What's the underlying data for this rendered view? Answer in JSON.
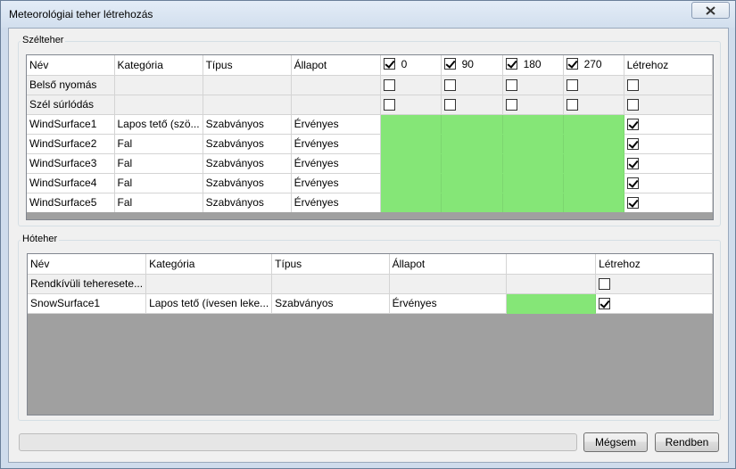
{
  "window": {
    "title": "Meteorológiai teher létrehozás"
  },
  "wind": {
    "group_label": "Szélteher",
    "columns": [
      "Név",
      "Kategória",
      "Típus",
      "Állapot",
      "0",
      "90",
      "180",
      "270",
      "Létrehoz"
    ],
    "header_checks": [
      true,
      true,
      true,
      true
    ],
    "special_rows": [
      {
        "name": "Belső nyomás",
        "checks": [
          false,
          false,
          false,
          false
        ],
        "create": false
      },
      {
        "name": "Szél súrlódás",
        "checks": [
          false,
          false,
          false,
          false
        ],
        "create": false
      }
    ],
    "rows": [
      {
        "name": "WindSurface1",
        "category": "Lapos tető (szö...",
        "type": "Szabványos",
        "status": "Érvényes",
        "create": true
      },
      {
        "name": "WindSurface2",
        "category": "Fal",
        "type": "Szabványos",
        "status": "Érvényes",
        "create": true
      },
      {
        "name": "WindSurface3",
        "category": "Fal",
        "type": "Szabványos",
        "status": "Érvényes",
        "create": true
      },
      {
        "name": "WindSurface4",
        "category": "Fal",
        "type": "Szabványos",
        "status": "Érvényes",
        "create": true
      },
      {
        "name": "WindSurface5",
        "category": "Fal",
        "type": "Szabványos",
        "status": "Érvényes",
        "create": true
      }
    ]
  },
  "snow": {
    "group_label": "Hóteher",
    "columns": [
      "Név",
      "Kategória",
      "Típus",
      "Állapot",
      "",
      "Létrehoz"
    ],
    "special_rows": [
      {
        "name": "Rendkívüli teheresete...",
        "create": false
      }
    ],
    "rows": [
      {
        "name": "SnowSurface1",
        "category": "Lapos tető (ívesen leke...",
        "type": "Szabványos",
        "status": "Érvényes",
        "create": true
      }
    ]
  },
  "footer": {
    "progress": 0,
    "cancel_label": "Mégsem",
    "ok_label": "Rendben"
  },
  "colors": {
    "valid_cell": "#85e677",
    "grid_empty": "#a0a0a0"
  }
}
